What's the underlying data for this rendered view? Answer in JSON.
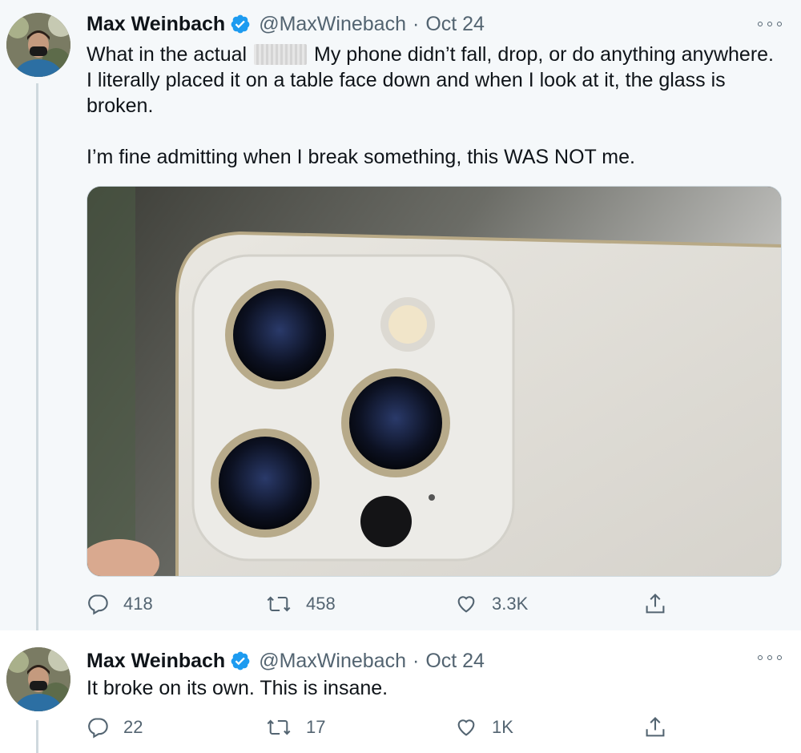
{
  "tweets": [
    {
      "author": {
        "name": "Max Weinbach",
        "handle": "@MaxWinebach",
        "separator": "·",
        "date": "Oct 24"
      },
      "text": {
        "line1_before": "What in the actual",
        "line1_after": "My phone didn’t fall, drop, or do anything anywhere. I literally placed it on a table face down and when I look at it, the glass is broken.",
        "para2": "I’m fine admitting when I break something, this WAS NOT me."
      },
      "stats": {
        "replies": "418",
        "retweets": "458",
        "likes": "3.3K"
      }
    },
    {
      "author": {
        "name": "Max Weinbach",
        "handle": "@MaxWinebach",
        "separator": "·",
        "date": "Oct 24"
      },
      "text": {
        "body": "It broke on its own. This is insane."
      },
      "stats": {
        "replies": "22",
        "retweets": "17",
        "likes": "1K"
      }
    }
  ],
  "colors": {
    "verified_blue": "#1d9bf0",
    "muted_text": "#536471",
    "highlighted_background": "#f5f8fa"
  },
  "icons": {
    "reply": "reply-icon",
    "retweet": "retweet-icon",
    "like": "like-icon",
    "share": "share-icon",
    "more": "more-icon",
    "verified": "verified-badge-icon"
  }
}
